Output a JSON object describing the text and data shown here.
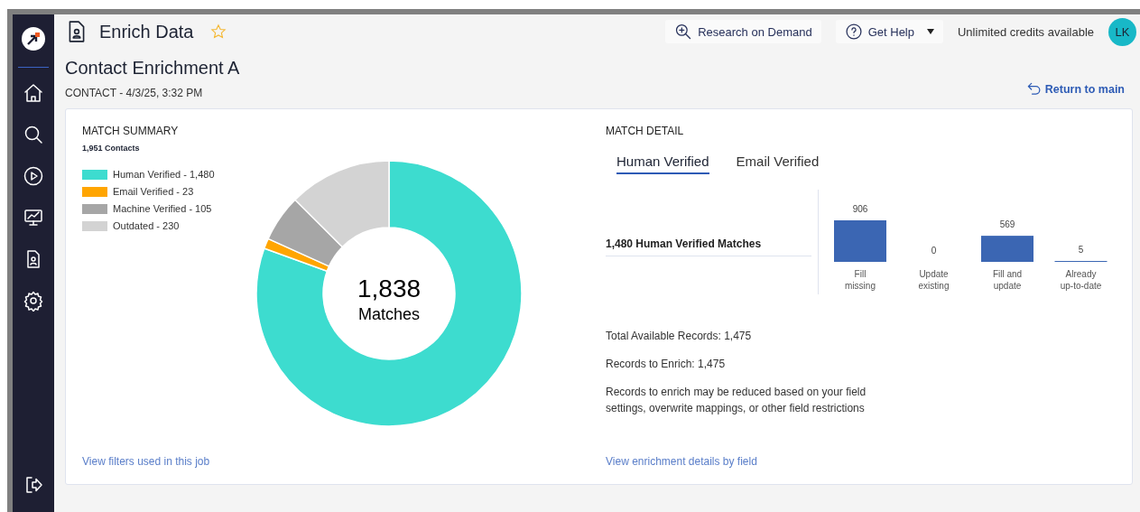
{
  "header": {
    "title": "Enrich Data",
    "favorite": false,
    "research_button": "Research on Demand",
    "help_button": "Get Help",
    "credits": "Unlimited credits available",
    "avatar": "LK"
  },
  "job": {
    "title": "Contact Enrichment A",
    "subtitle": "CONTACT - 4/3/25, 3:32 PM",
    "return_link": "Return to main"
  },
  "match_summary": {
    "title": "MATCH SUMMARY",
    "count": "1,951 Contacts",
    "legend": [
      {
        "color": "#3ddccf"
      },
      {
        "color": "#ffa500"
      },
      {
        "color": "#a6a6a6"
      },
      {
        "color": "#d3d3d3"
      }
    ],
    "chart_data": {
      "type": "donut",
      "categories": [
        "Human Verified - 1,480",
        "Email Verified - 23",
        "Machine Verified - 105",
        "Outdated - 230"
      ],
      "values": [
        80.52,
        1.25,
        5.71,
        12.52
      ]
    },
    "center_value": "1,838",
    "center_label": "Matches",
    "link": "View filters used in this job"
  },
  "match_detail": {
    "title": "MATCH DETAIL",
    "tabs": [
      {
        "label": "Human Verified",
        "selected": true
      },
      {
        "label": "Email Verified",
        "selected": false
      }
    ],
    "matches_label": "1,480 Human Verified Matches",
    "chart_data": {
      "type": "bar",
      "categories": [
        "Fill missing",
        "Update existing",
        "Fill and update",
        "Already up-to-date"
      ],
      "values": [
        906,
        0,
        569,
        5
      ],
      "data_labels": true
    },
    "notes": [
      "Total Available Records: 1,475",
      "Records to Enrich: 1,475",
      "Records to enrich may be reduced based on your field settings, overwrite mappings, or other field restrictions"
    ],
    "link": "View enrichment details by field"
  }
}
